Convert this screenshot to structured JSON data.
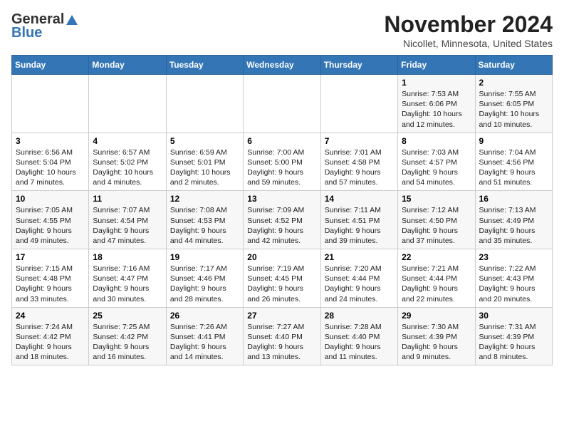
{
  "header": {
    "logo_line1": "General",
    "logo_line2": "Blue",
    "title": "November 2024",
    "subtitle": "Nicollet, Minnesota, United States"
  },
  "calendar": {
    "days_of_week": [
      "Sunday",
      "Monday",
      "Tuesday",
      "Wednesday",
      "Thursday",
      "Friday",
      "Saturday"
    ],
    "weeks": [
      [
        {
          "day": "",
          "info": ""
        },
        {
          "day": "",
          "info": ""
        },
        {
          "day": "",
          "info": ""
        },
        {
          "day": "",
          "info": ""
        },
        {
          "day": "",
          "info": ""
        },
        {
          "day": "1",
          "info": "Sunrise: 7:53 AM\nSunset: 6:06 PM\nDaylight: 10 hours\nand 12 minutes."
        },
        {
          "day": "2",
          "info": "Sunrise: 7:55 AM\nSunset: 6:05 PM\nDaylight: 10 hours\nand 10 minutes."
        }
      ],
      [
        {
          "day": "3",
          "info": "Sunrise: 6:56 AM\nSunset: 5:04 PM\nDaylight: 10 hours\nand 7 minutes."
        },
        {
          "day": "4",
          "info": "Sunrise: 6:57 AM\nSunset: 5:02 PM\nDaylight: 10 hours\nand 4 minutes."
        },
        {
          "day": "5",
          "info": "Sunrise: 6:59 AM\nSunset: 5:01 PM\nDaylight: 10 hours\nand 2 minutes."
        },
        {
          "day": "6",
          "info": "Sunrise: 7:00 AM\nSunset: 5:00 PM\nDaylight: 9 hours\nand 59 minutes."
        },
        {
          "day": "7",
          "info": "Sunrise: 7:01 AM\nSunset: 4:58 PM\nDaylight: 9 hours\nand 57 minutes."
        },
        {
          "day": "8",
          "info": "Sunrise: 7:03 AM\nSunset: 4:57 PM\nDaylight: 9 hours\nand 54 minutes."
        },
        {
          "day": "9",
          "info": "Sunrise: 7:04 AM\nSunset: 4:56 PM\nDaylight: 9 hours\nand 51 minutes."
        }
      ],
      [
        {
          "day": "10",
          "info": "Sunrise: 7:05 AM\nSunset: 4:55 PM\nDaylight: 9 hours\nand 49 minutes."
        },
        {
          "day": "11",
          "info": "Sunrise: 7:07 AM\nSunset: 4:54 PM\nDaylight: 9 hours\nand 47 minutes."
        },
        {
          "day": "12",
          "info": "Sunrise: 7:08 AM\nSunset: 4:53 PM\nDaylight: 9 hours\nand 44 minutes."
        },
        {
          "day": "13",
          "info": "Sunrise: 7:09 AM\nSunset: 4:52 PM\nDaylight: 9 hours\nand 42 minutes."
        },
        {
          "day": "14",
          "info": "Sunrise: 7:11 AM\nSunset: 4:51 PM\nDaylight: 9 hours\nand 39 minutes."
        },
        {
          "day": "15",
          "info": "Sunrise: 7:12 AM\nSunset: 4:50 PM\nDaylight: 9 hours\nand 37 minutes."
        },
        {
          "day": "16",
          "info": "Sunrise: 7:13 AM\nSunset: 4:49 PM\nDaylight: 9 hours\nand 35 minutes."
        }
      ],
      [
        {
          "day": "17",
          "info": "Sunrise: 7:15 AM\nSunset: 4:48 PM\nDaylight: 9 hours\nand 33 minutes."
        },
        {
          "day": "18",
          "info": "Sunrise: 7:16 AM\nSunset: 4:47 PM\nDaylight: 9 hours\nand 30 minutes."
        },
        {
          "day": "19",
          "info": "Sunrise: 7:17 AM\nSunset: 4:46 PM\nDaylight: 9 hours\nand 28 minutes."
        },
        {
          "day": "20",
          "info": "Sunrise: 7:19 AM\nSunset: 4:45 PM\nDaylight: 9 hours\nand 26 minutes."
        },
        {
          "day": "21",
          "info": "Sunrise: 7:20 AM\nSunset: 4:44 PM\nDaylight: 9 hours\nand 24 minutes."
        },
        {
          "day": "22",
          "info": "Sunrise: 7:21 AM\nSunset: 4:44 PM\nDaylight: 9 hours\nand 22 minutes."
        },
        {
          "day": "23",
          "info": "Sunrise: 7:22 AM\nSunset: 4:43 PM\nDaylight: 9 hours\nand 20 minutes."
        }
      ],
      [
        {
          "day": "24",
          "info": "Sunrise: 7:24 AM\nSunset: 4:42 PM\nDaylight: 9 hours\nand 18 minutes."
        },
        {
          "day": "25",
          "info": "Sunrise: 7:25 AM\nSunset: 4:42 PM\nDaylight: 9 hours\nand 16 minutes."
        },
        {
          "day": "26",
          "info": "Sunrise: 7:26 AM\nSunset: 4:41 PM\nDaylight: 9 hours\nand 14 minutes."
        },
        {
          "day": "27",
          "info": "Sunrise: 7:27 AM\nSunset: 4:40 PM\nDaylight: 9 hours\nand 13 minutes."
        },
        {
          "day": "28",
          "info": "Sunrise: 7:28 AM\nSunset: 4:40 PM\nDaylight: 9 hours\nand 11 minutes."
        },
        {
          "day": "29",
          "info": "Sunrise: 7:30 AM\nSunset: 4:39 PM\nDaylight: 9 hours\nand 9 minutes."
        },
        {
          "day": "30",
          "info": "Sunrise: 7:31 AM\nSunset: 4:39 PM\nDaylight: 9 hours\nand 8 minutes."
        }
      ]
    ]
  }
}
